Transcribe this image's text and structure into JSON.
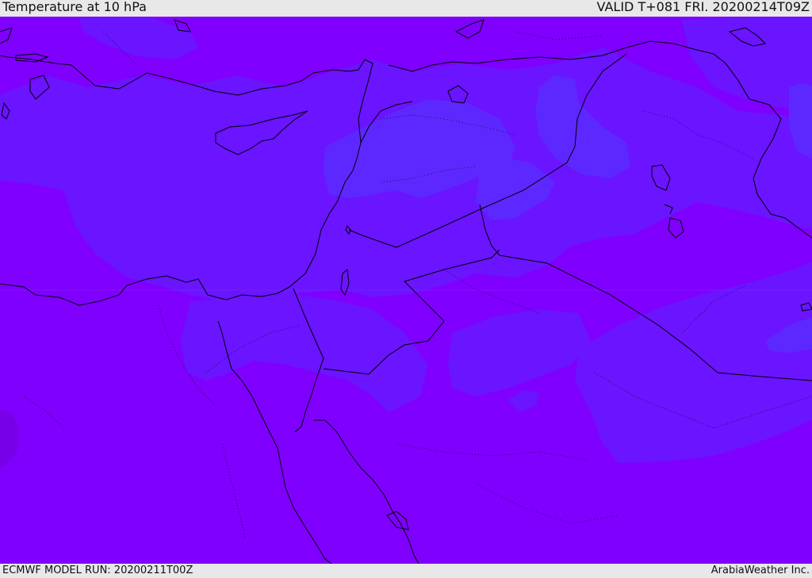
{
  "header": {
    "title": "Temperature at 10 hPa",
    "valid": "VALID T+081 FRI. 20200214T09Z"
  },
  "footer": {
    "model_run": "ECMWF MODEL RUN: 20200211T00Z",
    "credit": "ArabiaWeather Inc."
  },
  "colors": {
    "base_fill": "#7f00ff",
    "warm_band": "#6a14ff",
    "warmer_band": "#5d28ff",
    "cold_patch": "#7800e8",
    "coastline": "#000000",
    "frame": "#e8e8e8"
  }
}
